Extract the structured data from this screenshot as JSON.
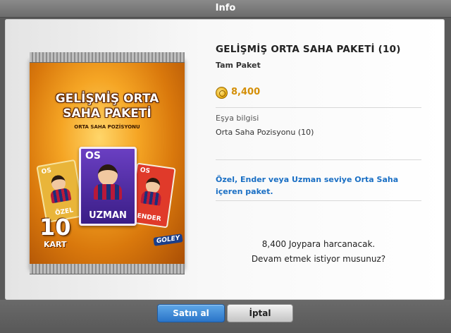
{
  "window": {
    "title": "Info"
  },
  "pack": {
    "title": "GELİŞMİŞ ORTA SAHA PAKETİ",
    "subtitle": "ORTA SAHA POZİSYONU",
    "card_center": {
      "position": "OS",
      "level": "UZMAN"
    },
    "card_left": {
      "position": "OS",
      "level": "ÖZEL"
    },
    "card_right": {
      "position": "OS",
      "level": "ENDER"
    },
    "count": "10",
    "count_label": "KART",
    "brand": "GOLEY"
  },
  "product": {
    "title": "GELİŞMİŞ ORTA SAHA PAKETİ (10)",
    "subtitle": "Tam Paket",
    "price": "8,400",
    "item_info_label": "Eşya bilgisi",
    "item_info_value": "Orta Saha Pozisyonu (10)",
    "description": "Özel, Ender veya Uzman seviye Orta Saha içeren paket.",
    "confirm_line1": "8,400 Joypara harcanacak.",
    "confirm_line2": "Devam etmek istiyor musunuz?"
  },
  "buttons": {
    "buy": "Satın al",
    "cancel": "İptal"
  },
  "colors": {
    "accent_blue": "#2a74c8",
    "price_gold": "#d48f08",
    "description_blue": "#1a6fc4"
  }
}
